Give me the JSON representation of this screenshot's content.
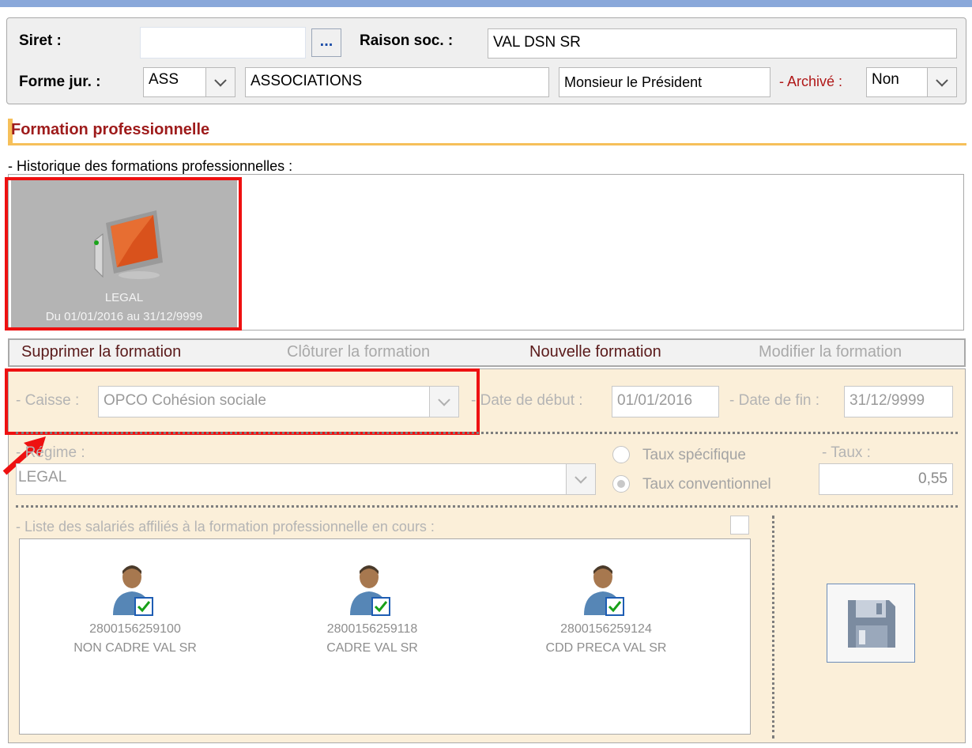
{
  "header": {
    "siret_label": "Siret :",
    "siret_value": "",
    "browse_label": "...",
    "raison_label": "Raison soc. :",
    "raison_value": "VAL DSN SR",
    "forme_label": "Forme jur. :",
    "forme_code": "ASS",
    "forme_name": "ASSOCIATIONS",
    "titre_value": "Monsieur le Président",
    "archive_label": "- Archivé :",
    "archive_value": "Non"
  },
  "section": {
    "title": "Formation professionnelle",
    "history_label": "- Historique des formations professionnelles :"
  },
  "history": [
    {
      "icon": "monitor-icon",
      "line1": "LEGAL",
      "line2": "Du 01/01/2016 au 31/12/9999",
      "selected": true
    }
  ],
  "actions": [
    {
      "label": "Supprimer la formation",
      "enabled": true
    },
    {
      "label": "Clôturer la formation",
      "enabled": false
    },
    {
      "label": "Nouvelle formation",
      "enabled": true
    },
    {
      "label": "Modifier la formation",
      "enabled": false
    }
  ],
  "details": {
    "caisse_label": "- Caisse :",
    "caisse_value": "OPCO Cohésion sociale",
    "date_debut_label": "- Date de début :",
    "date_debut_value": "01/01/2016",
    "date_fin_label": "- Date de fin :",
    "date_fin_value": "31/12/9999",
    "regime_label": "- Régime :",
    "regime_value": "LEGAL",
    "taux_specifique_label": "Taux spécifique",
    "taux_conventionnel_label": "Taux conventionnel",
    "taux_selected": "conventionnel",
    "taux_label": "- Taux :",
    "taux_value": "0,55",
    "list_label": "- Liste des salariés affiliés à la formation professionnelle en cours :"
  },
  "employees": [
    {
      "id": "2800156259100",
      "name": "NON CADRE VAL SR",
      "checked": true
    },
    {
      "id": "2800156259118",
      "name": "CADRE  VAL SR",
      "checked": true
    },
    {
      "id": "2800156259124",
      "name": "CDD PRECA VAL SR",
      "checked": true
    }
  ],
  "colors": {
    "section_title": "#9e1b1b",
    "accent_bar": "#f6c05a",
    "panel_bg": "#fbefd9",
    "highlight": "#ee1111",
    "topbar": "#8aa8da"
  }
}
